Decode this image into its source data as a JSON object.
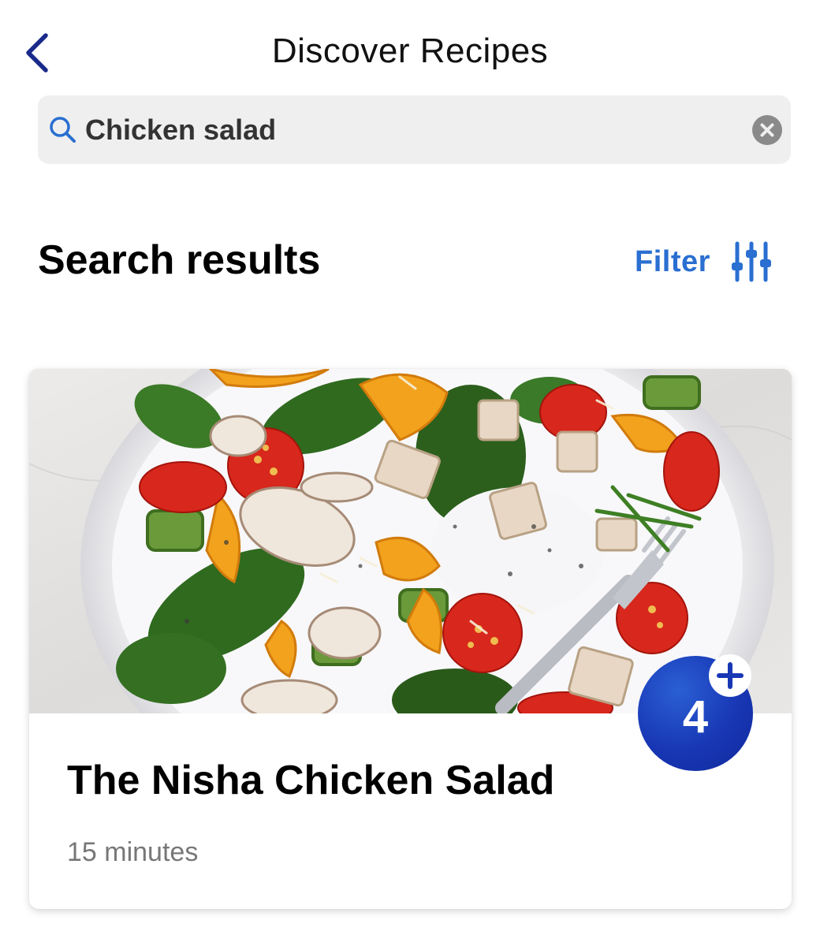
{
  "header": {
    "title": "Discover Recipes",
    "back_icon": "chevron-left-icon"
  },
  "search": {
    "value": "Chicken salad",
    "icon": "search-icon",
    "clear_icon": "clear-circle-icon"
  },
  "results": {
    "heading": "Search results",
    "filter_label": "Filter",
    "filter_icon": "sliders-icon"
  },
  "recipes": [
    {
      "title": "The Nisha Chicken Salad",
      "time": "15 minutes",
      "points": "4",
      "points_icon": "plus-icon",
      "image": "chicken-salad-bowl-photo"
    }
  ],
  "colors": {
    "accent": "#2a6fd1",
    "badge": "#1837b5",
    "back": "#1a2a8a"
  }
}
